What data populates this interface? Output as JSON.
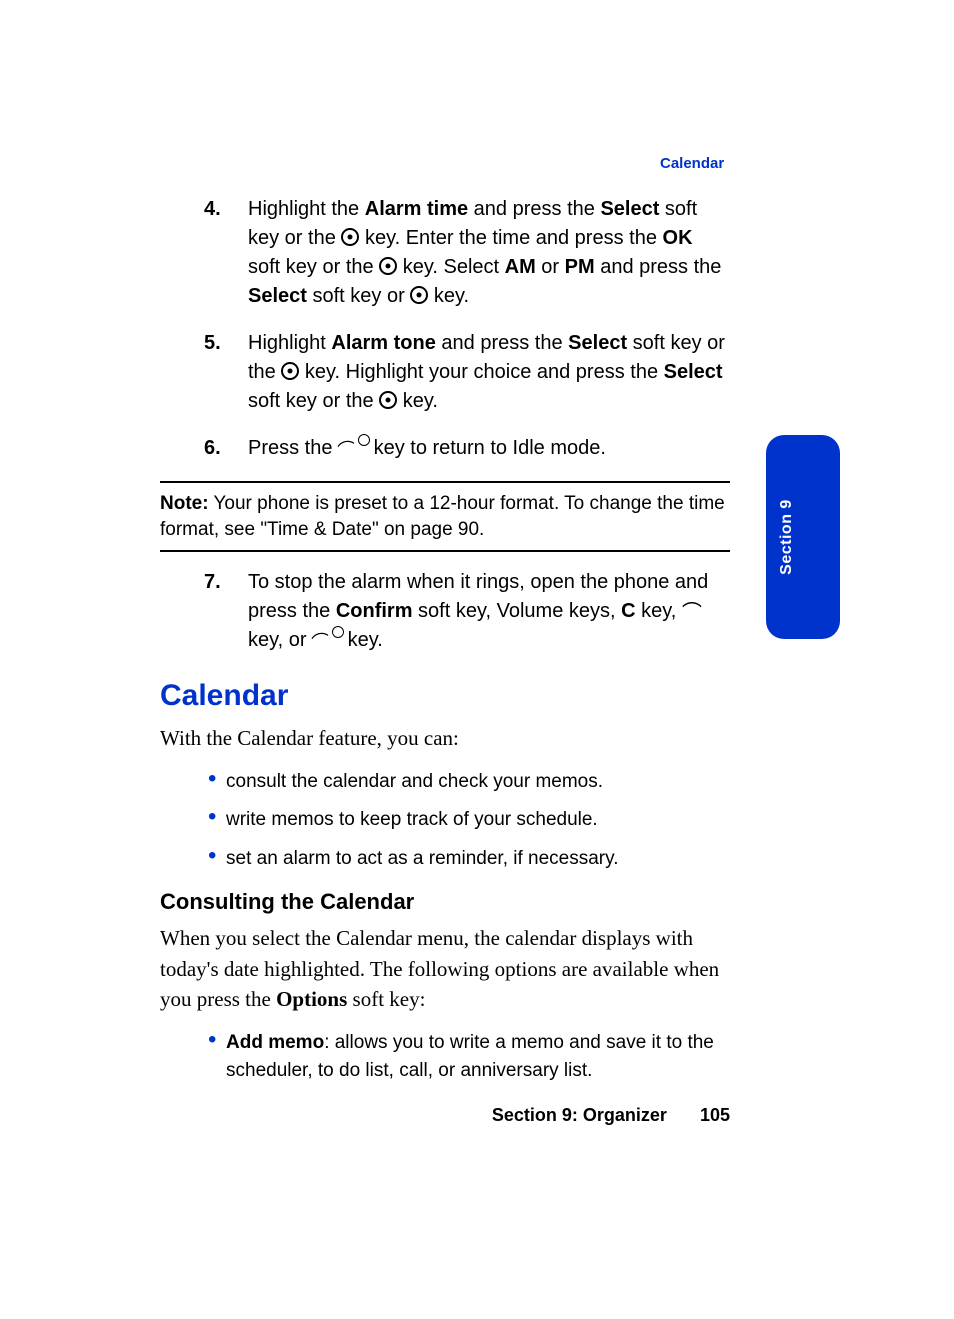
{
  "header": {
    "running_head": "Calendar"
  },
  "steps_a": [
    {
      "num": "4.",
      "html": "Highlight the <b>Alarm time</b> and press the <b>Select</b> soft key or the {ok} key. Enter the time and press the <b>OK</b> soft key or the {ok} key. Select <b>AM</b> or <b>PM</b> and press the <b>Select</b> soft key or {ok} key."
    },
    {
      "num": "5.",
      "html": "Highlight <b>Alarm tone</b> and press the <b>Select</b> soft key or the {ok} key. Highlight your choice and press the <b>Select</b> soft key or the {ok} key."
    },
    {
      "num": "6.",
      "html": "Press the {end} key to return to Idle mode."
    }
  ],
  "note": {
    "label": "Note:",
    "text": " Your phone is preset to a 12-hour format. To change the time format, see \"Time & Date\" on page 90."
  },
  "steps_b": [
    {
      "num": "7.",
      "html": "To stop the alarm when it rings, open the phone and press the <b>Confirm</b> soft key, Volume keys, <b>C</b> key, {send} key, or {end} key."
    }
  ],
  "calendar": {
    "heading": "Calendar",
    "intro": "With the Calendar feature, you can:",
    "bullets": [
      "consult the calendar and check your memos.",
      "write memos to keep track of your schedule.",
      "set an alarm to act as a reminder, if necessary."
    ],
    "sub": {
      "heading": "Consulting the Calendar",
      "para": "When you select the Calendar menu, the calendar displays with today's date highlighted. The following options are available when you press the <b>Options</b> soft key:",
      "bullets": [
        {
          "term": "Add memo",
          "rest": ": allows you to write a memo and save it to the scheduler, to do list, call, or anniversary list."
        }
      ]
    }
  },
  "side_tab": "Section 9",
  "footer": {
    "section": "Section 9: Organizer",
    "page": "105"
  }
}
